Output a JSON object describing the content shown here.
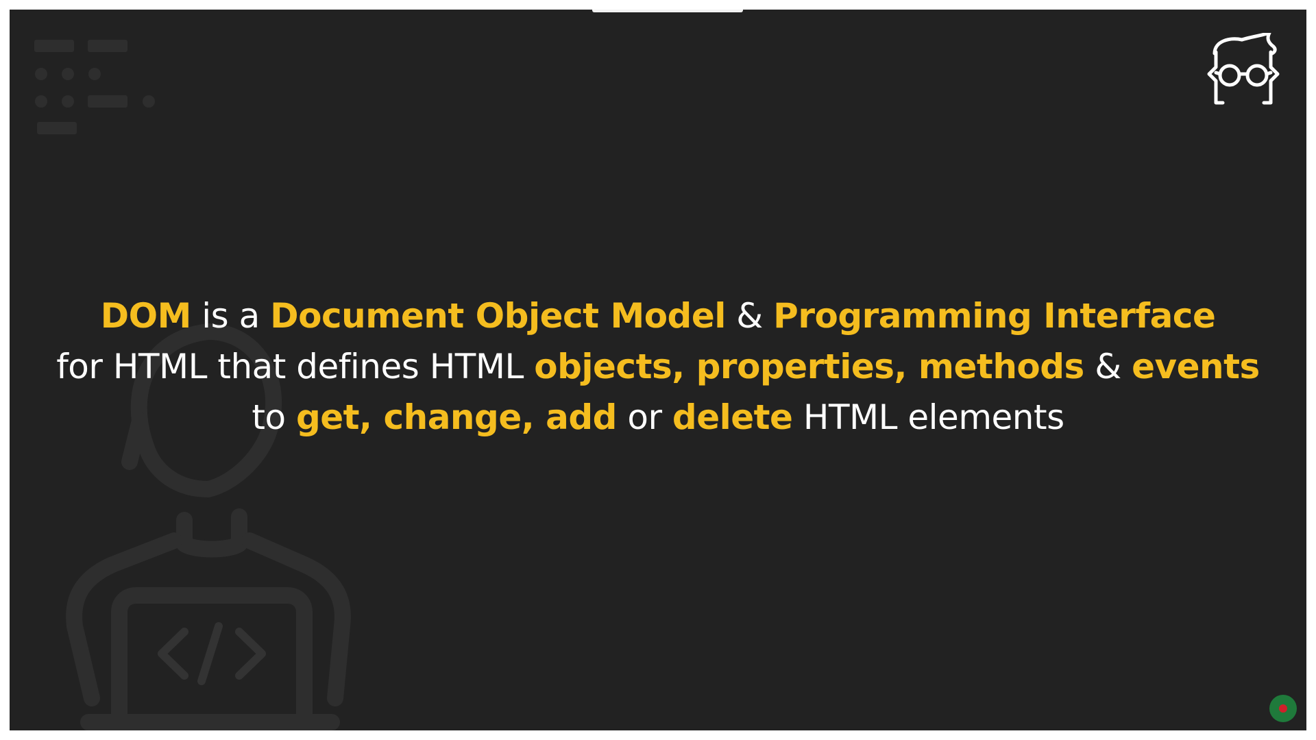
{
  "slide": {
    "line1": {
      "dom": "DOM",
      "is_a": " is a ",
      "document_object_model": "Document Object Model",
      "amp": " & ",
      "programming_interface": "Programming Interface"
    },
    "line2": {
      "for_html": "for HTML that defines HTML ",
      "objects_properties_methods": "objects, properties, methods",
      "amp": " & ",
      "events": "events"
    },
    "line3": {
      "to": "to ",
      "get_change_add": "get, change, add",
      "or": " or ",
      "delete": "delete",
      "html_elements": " HTML elements"
    }
  },
  "colors": {
    "background": "#222222",
    "highlight": "#f5bd1f",
    "text": "#ffffff",
    "decoration": "#2e2e2e"
  },
  "icons": {
    "logo": "developer-glasses-logo-icon",
    "background_illustration": "developer-at-laptop-icon",
    "code_glyph": "code-tag-icon",
    "record_indicator": "record-indicator-icon"
  }
}
